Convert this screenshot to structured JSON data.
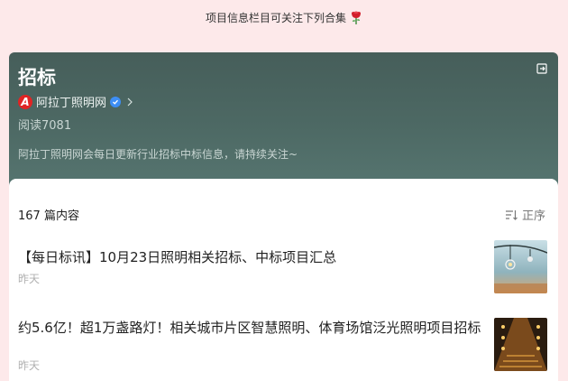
{
  "top_note": "项目信息栏目可关注下列合集",
  "header": {
    "title": "招标",
    "account_name": "阿拉丁照明网",
    "logo_letter": "A",
    "reads": "阅读7081",
    "description": "阿拉丁照明网会每日更新行业招标中标信息，请持续关注~"
  },
  "list": {
    "count": "167 篇内容",
    "sort_label": "正序",
    "articles": [
      {
        "title": "【每日标讯】10月23日照明相关招标、中标项目汇总",
        "time": "昨天"
      },
      {
        "title": "约5.6亿！超1万盏路灯！相关城市片区智慧照明、体育场馆泛光照明项目招标",
        "time": "昨天"
      }
    ]
  },
  "colors": {
    "header_bg": "#4d6964",
    "page_bg": "#fde9ea",
    "logo_red": "#e02424",
    "verify_blue": "#3d8ef5"
  }
}
